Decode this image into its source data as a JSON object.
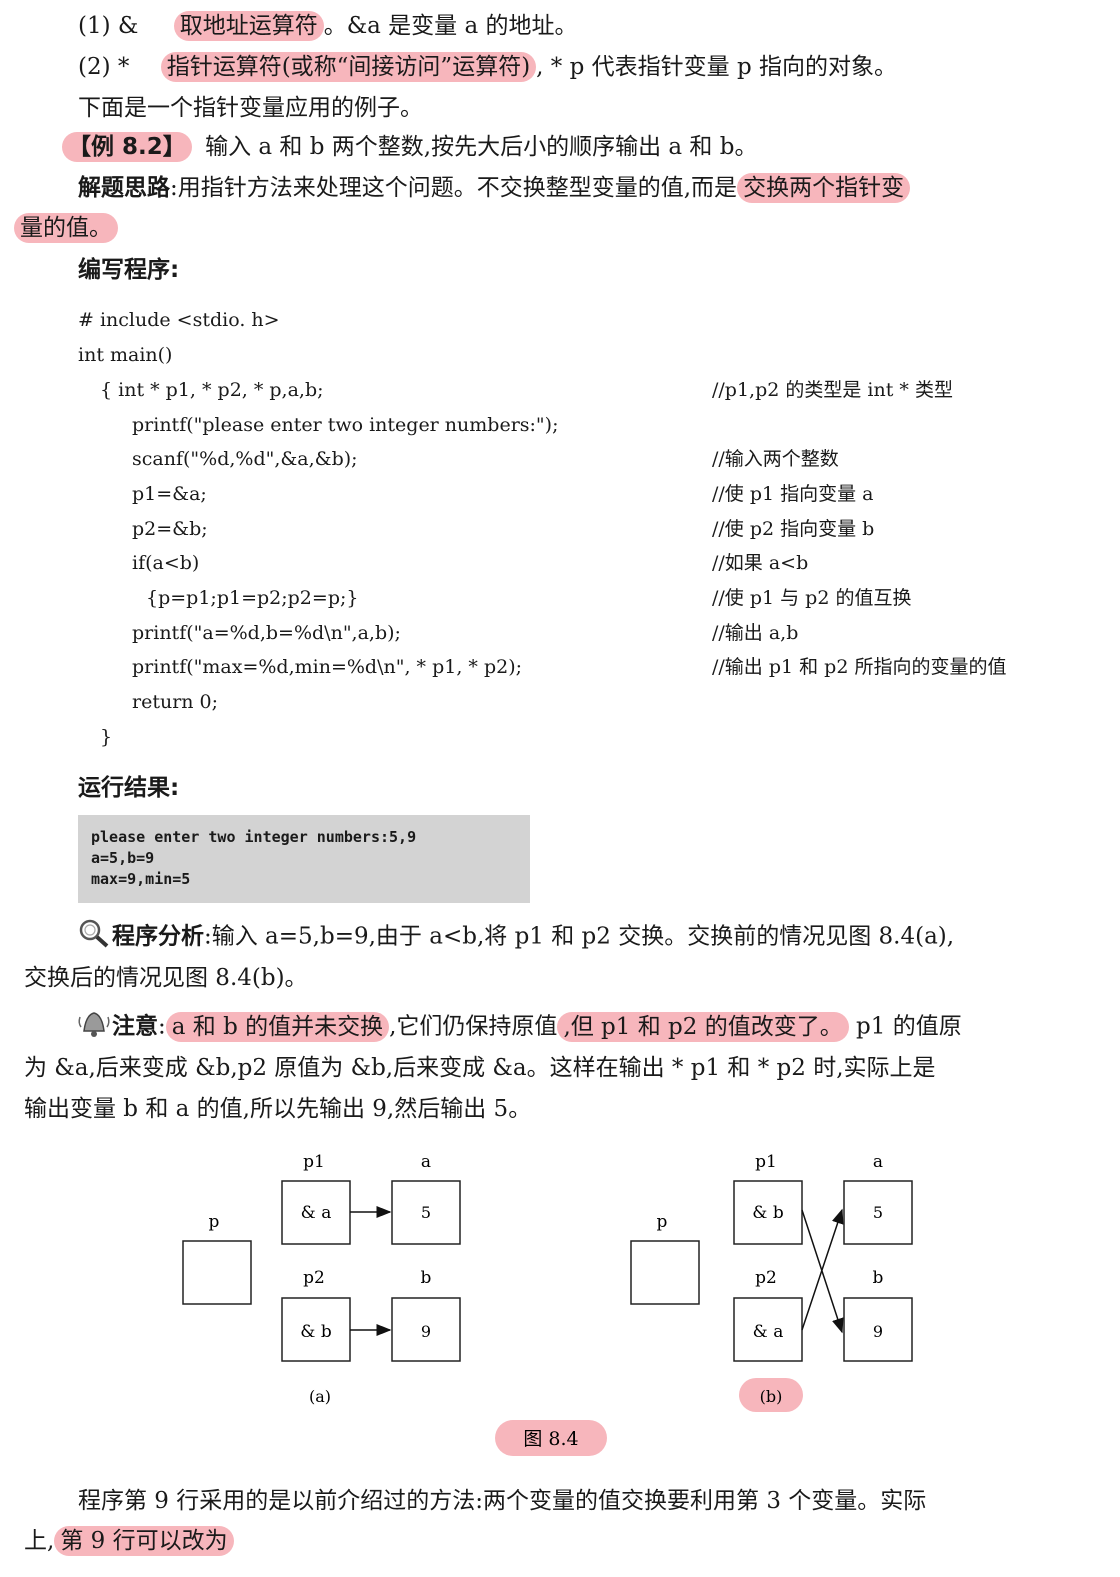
{
  "intro": {
    "l1_num": "(1) &",
    "l1_hl": "取地址运算符",
    "l1_rest": "。&a 是变量 a 的地址。",
    "l2_num": "(2) *",
    "l2_hl": "指针运算符(或称“间接访问”运算符)",
    "l2_rest": ", * p 代表指针变量 p 指向的对象。",
    "l3": "下面是一个指针变量应用的例子。"
  },
  "example": {
    "tag": "【例 8.2】",
    "text": "输入 a 和 b 两个整数,按先大后小的顺序输出 a 和 b。"
  },
  "idea": {
    "label": "解题思路",
    "text": ":用指针方法来处理这个问题。不交换整型变量的值,而是",
    "hl1": "交换两个指针变",
    "hl2": "量的值。"
  },
  "write_label": "编写程序:",
  "code": [
    {
      "text": "# include <stdio. h>",
      "comment": ""
    },
    {
      "text": "int main()",
      "comment": ""
    },
    {
      "text": "{ int * p1, * p2, * p,a,b;",
      "comment": "//p1,p2 的类型是 int * 类型"
    },
    {
      "text": "printf(\"please enter two integer numbers:\");",
      "comment": ""
    },
    {
      "text": "scanf(\"%d,%d\",&a,&b);",
      "comment": "//输入两个整数"
    },
    {
      "text": "p1=&a;",
      "comment": "//使 p1 指向变量 a"
    },
    {
      "text": "p2=&b;",
      "comment": "//使 p2 指向变量 b"
    },
    {
      "text": "if(a<b)",
      "comment": "//如果 a<b"
    },
    {
      "text": "{p=p1;p1=p2;p2=p;}",
      "comment": "//使 p1 与 p2 的值互换"
    },
    {
      "text": "printf(\"a=%d,b=%d\\n\",a,b);",
      "comment": "//输出 a,b"
    },
    {
      "text": "printf(\"max=%d,min=%d\\n\", * p1, * p2);",
      "comment": "//输出 p1 和 p2 所指向的变量的值"
    },
    {
      "text": "return 0;",
      "comment": ""
    },
    {
      "text": "}",
      "comment": ""
    }
  ],
  "run_label": "运行结果:",
  "output": [
    "please enter two integer numbers:5,9",
    "a=5,b=9",
    "max=9,min=5"
  ],
  "analysis": {
    "label": "程序分析",
    "text1": ":输入 a=5,b=9,由于 a<b,将 p1 和 p2 交换。交换前的情况见图 8.4(a),",
    "text2": "交换后的情况见图 8.4(b)。"
  },
  "note": {
    "label": "注意",
    "colon": ":",
    "hl1": "a 和 b 的值并未交换",
    "mid": ",它们仍保持原值",
    "hl2": ",但 p1 和 p2 的值改变了。",
    "rest1": "p1 的值原",
    "line2": "为 &a,后来变成 &b,p2 原值为 &b,后来变成 &a。这样在输出 * p1 和 * p2 时,实际上是",
    "line3": "输出变量 b 和 a 的值,所以先输出 9,然后输出 5。"
  },
  "figure": {
    "a": {
      "p_label": "p",
      "p1_label": "p1",
      "a_label": "a",
      "p2_label": "p2",
      "b_label": "b",
      "p1_val": "& a",
      "a_val": "5",
      "p2_val": "& b",
      "b_val": "9",
      "caption": "(a)"
    },
    "b": {
      "p_label": "p",
      "p1_label": "p1",
      "a_label": "a",
      "p2_label": "p2",
      "b_label": "b",
      "p1_val": "& b",
      "a_val": "5",
      "p2_val": "& a",
      "b_val": "9",
      "caption": "(b)"
    },
    "title": "图   8.4"
  },
  "final": {
    "line1": "程序第 9 行采用的是以前介绍过的方法:两个变量的值交换要利用第 3 个变量。实际",
    "line2_pre": "上,",
    "line2_hl": "第 9 行可以改为"
  }
}
